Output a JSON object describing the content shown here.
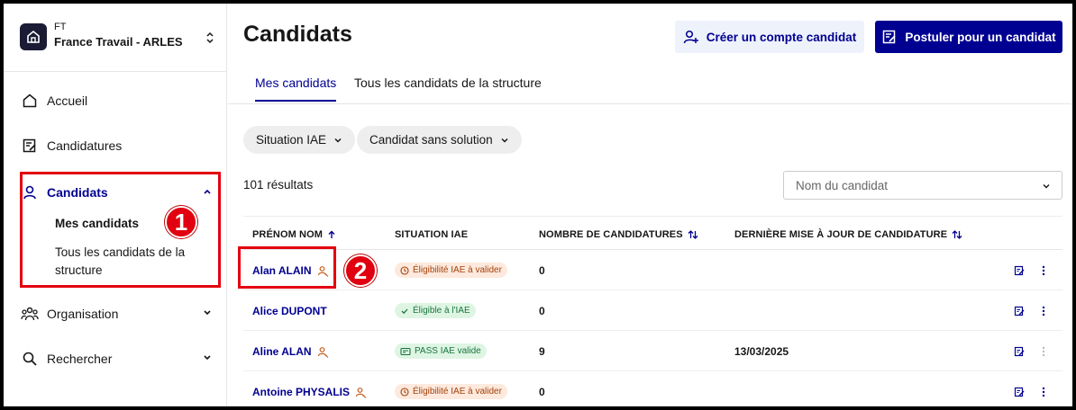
{
  "organization": {
    "small_label": "FT",
    "name": "France Travail - ARLES"
  },
  "sidebar": {
    "items": [
      {
        "label": "Accueil",
        "icon": "home-icon"
      },
      {
        "label": "Candidatures",
        "icon": "edit-document-icon"
      },
      {
        "label": "Candidats",
        "icon": "user-icon",
        "expanded": true
      },
      {
        "label": "Organisation",
        "icon": "team-icon"
      },
      {
        "label": "Rechercher",
        "icon": "search-icon"
      }
    ],
    "candidats_sub": [
      {
        "label": "Mes candidats",
        "active": true
      },
      {
        "label": "Tous les candidats de la structure",
        "active": false
      }
    ]
  },
  "annotations": {
    "step1": "1",
    "step2": "2"
  },
  "page": {
    "title": "Candidats",
    "create_button": "Créer un compte candidat",
    "apply_button": "Postuler pour un candidat"
  },
  "tabs": [
    {
      "label": "Mes candidats",
      "active": true
    },
    {
      "label": "Tous les candidats de la structure",
      "active": false
    }
  ],
  "filters": [
    {
      "label": "Situation IAE"
    },
    {
      "label": "Candidat sans solution"
    }
  ],
  "results_text": "101 résultats",
  "search": {
    "placeholder": "Nom du candidat"
  },
  "table": {
    "headers": {
      "name": "PRÉNOM NOM",
      "situation": "SITUATION IAE",
      "count": "NOMBRE DE CANDIDATURES",
      "updated": "DERNIÈRE MISE À JOUR DE CANDIDATURE"
    },
    "rows": [
      {
        "name": "Alan ALAIN",
        "has_tag": true,
        "status": "Éligibilité IAE à valider",
        "status_type": "warning",
        "count": "0",
        "date": ""
      },
      {
        "name": "Alice DUPONT",
        "has_tag": false,
        "status": "Éligible à l'IAE",
        "status_type": "success",
        "count": "0",
        "date": ""
      },
      {
        "name": "Aline ALAN",
        "has_tag": true,
        "status": "PASS IAE valide",
        "status_type": "pass",
        "count": "9",
        "date": "13/03/2025"
      },
      {
        "name": "Antoine PHYSALIS",
        "has_tag": true,
        "status": "Éligibilité IAE à valider",
        "status_type": "warning",
        "count": "0",
        "date": ""
      }
    ]
  },
  "colors": {
    "primary": "#000091",
    "annotation_red": "#e1000f",
    "warning_text": "#a3410a",
    "success_text": "#18753c"
  }
}
